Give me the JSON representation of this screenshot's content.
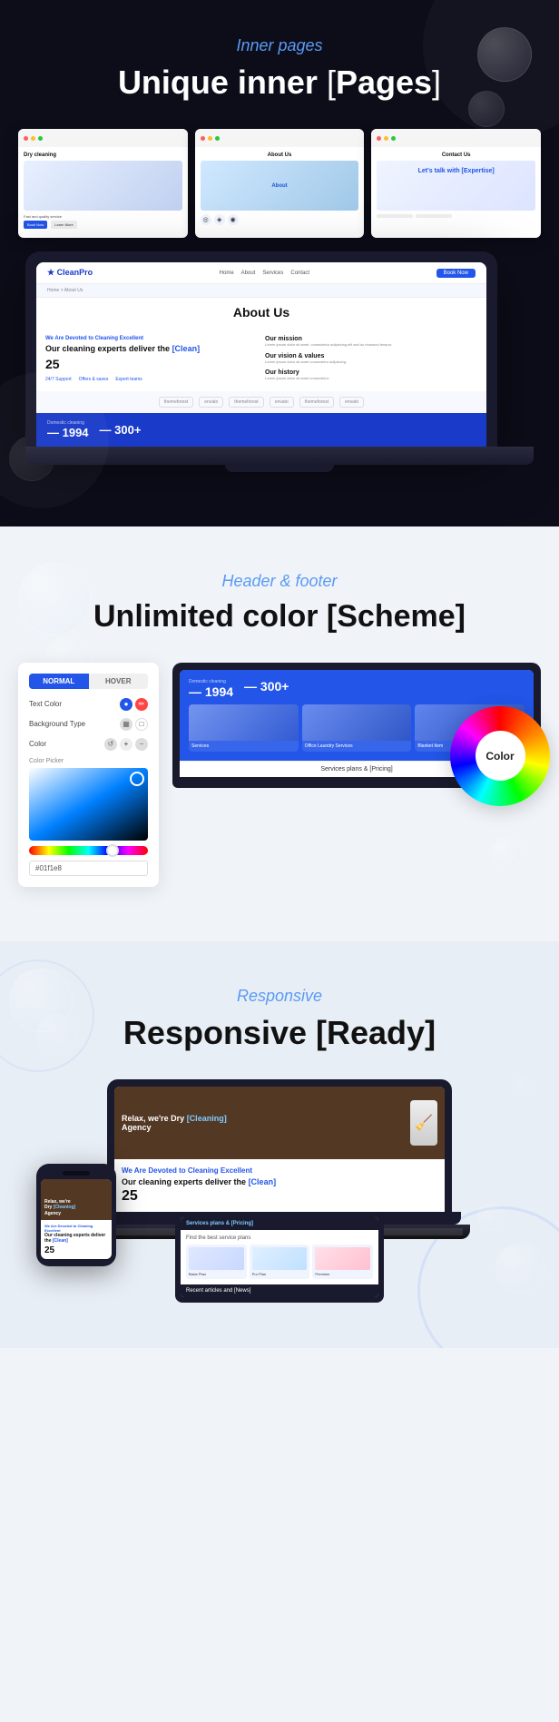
{
  "section1": {
    "label": "Inner pages",
    "title_start": "Unique inner ",
    "title_bracket_open": "[",
    "title_word": "Pages",
    "title_bracket_close": "]",
    "cards": [
      {
        "title": "Dry cleaning",
        "type": "dry"
      },
      {
        "title": "About Us",
        "type": "about"
      },
      {
        "title": "Contact Us",
        "type": "contact"
      }
    ],
    "laptop_screen": {
      "about_title": "About Us",
      "breadcrumb": "Home > About Us",
      "hero_label": "We Are Devoted to Cleaning Excellent",
      "hero_heading": "Our cleaning experts deliver the [Clean]",
      "stat_num": "25",
      "support": "24/7 Support",
      "offers": "Offers & saves",
      "expert": "Expert teams",
      "mission_title": "Our mission",
      "vision_title": "Our vision & values",
      "history_title": "Our history",
      "logos": [
        "themeforest",
        "envato",
        "themeforest",
        "envato",
        "themeforest",
        "envato"
      ],
      "stat1_label": "Domestic cleaning",
      "stat1_value": "— 1994",
      "stat2_value": "— 300+"
    }
  },
  "section2": {
    "label": "Header & footer",
    "title_start": "Unlimited color ",
    "title_bracket_open": "[",
    "title_word": "Scheme",
    "title_bracket_close": "]",
    "panel": {
      "tab_normal": "NORMAL",
      "tab_hover": "HOVER",
      "text_color": "Text Color",
      "background_type": "Background Type",
      "color": "Color",
      "color_picker": "Color Picker",
      "hex_value": "#01f1e8"
    },
    "laptop_screen": {
      "stat1_label": "Domestic cleaning",
      "stat1_value": "— 1994",
      "stat2_value": "— 300+",
      "service1": "Services",
      "service2": "Office Laundry Services",
      "service3": "Blanket Item",
      "footer_text": "Services plans & [Pricing]"
    },
    "color_wheel_label": "Color"
  },
  "section3": {
    "label": "Responsive",
    "title_start": "Responsive ",
    "title_bracket_open": "[",
    "title_word": "Ready",
    "title_bracket_close": "]",
    "laptop_screen": {
      "hero_text_start": "Relax, we're Dry ",
      "hero_bracket_open": "[",
      "hero_word": "Cleaning",
      "hero_bracket_close": "]",
      "hero_text_end": "Agency",
      "about_label": "We Are Devoted to Cleaning Excellent",
      "about_heading": "Our cleaning experts deliver the [Clean]",
      "stat_num": "25"
    },
    "tablet_screen": {
      "header": "Services plans & [Pricing]",
      "content": "Find the best service plans",
      "recent_news": "Recent articles and [News]"
    },
    "phone_screen": {
      "hero_text": "Relax, we're Dry [Cleaning] Agency",
      "about_label": "We Are Devoted to Cleaning Excellent",
      "about_heading": "Our cleaning experts deliver the [Clean]",
      "stat_num": "25"
    }
  }
}
